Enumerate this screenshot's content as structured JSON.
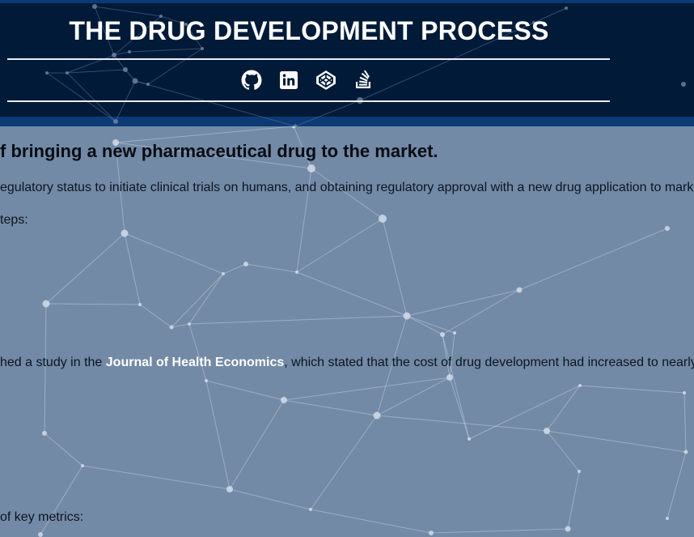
{
  "header": {
    "title": "THE DRUG DEVELOPMENT PROCESS",
    "social_icons": [
      "github-icon",
      "linkedin-icon",
      "codepen-icon",
      "stackoverflow-icon"
    ]
  },
  "content": {
    "headline": "f bringing a new pharmaceutical drug to the market.",
    "paragraph_1": "egulatory status to initiate clinical trials on humans, and obtaining regulatory approval with a new drug application to market",
    "paragraph_2": "teps:",
    "paragraph_3_before": "hed a study in the ",
    "paragraph_3_link": "Journal of Health Economics",
    "paragraph_3_after": ", which stated that the cost of drug development had increased to nearly",
    "paragraph_4": "of key metrics:"
  },
  "colors": {
    "page_background": "#728aa6",
    "header_background": "#001a38",
    "header_border": "#0c3a75",
    "link": "#ffffff",
    "text": "#0d1420"
  }
}
